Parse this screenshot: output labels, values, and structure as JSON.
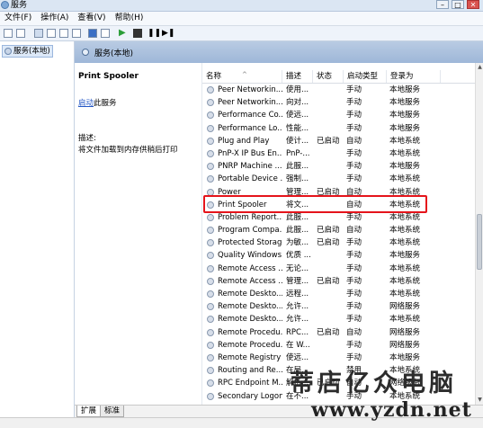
{
  "window": {
    "title": "服务"
  },
  "menu": [
    "文件(F)",
    "操作(A)",
    "查看(V)",
    "帮助(H)"
  ],
  "tree": {
    "item": "服务(本地)"
  },
  "header": {
    "title": "服务(本地)"
  },
  "detail": {
    "service_name": "Print Spooler",
    "action_link": "启动",
    "action_suffix": "此服务",
    "desc_label": "描述:",
    "desc_text": "将文件加载到内存供稍后打印"
  },
  "columns": [
    "名称",
    "描述",
    "状态",
    "启动类型",
    "登录为"
  ],
  "rows": [
    {
      "name": "Peer Networkin...",
      "desc": "使用...",
      "status": "",
      "start": "手动",
      "login": "本地服务"
    },
    {
      "name": "Peer Networkin...",
      "desc": "向对...",
      "status": "",
      "start": "手动",
      "login": "本地服务"
    },
    {
      "name": "Performance Co...",
      "desc": "使远...",
      "status": "",
      "start": "手动",
      "login": "本地服务"
    },
    {
      "name": "Performance Lo...",
      "desc": "性能...",
      "status": "",
      "start": "手动",
      "login": "本地服务"
    },
    {
      "name": "Plug and Play",
      "desc": "使计...",
      "status": "已启动",
      "start": "自动",
      "login": "本地系统"
    },
    {
      "name": "PnP-X IP Bus En...",
      "desc": "PnP-...",
      "status": "",
      "start": "手动",
      "login": "本地系统"
    },
    {
      "name": "PNRP Machine ...",
      "desc": "此服...",
      "status": "",
      "start": "手动",
      "login": "本地服务"
    },
    {
      "name": "Portable Device ...",
      "desc": "强制...",
      "status": "",
      "start": "手动",
      "login": "本地系统"
    },
    {
      "name": "Power",
      "desc": "管理...",
      "status": "已启动",
      "start": "自动",
      "login": "本地系统"
    },
    {
      "name": "Print Spooler",
      "desc": "将文...",
      "status": "",
      "start": "自动",
      "login": "本地系统"
    },
    {
      "name": "Problem Report...",
      "desc": "此服...",
      "status": "",
      "start": "手动",
      "login": "本地系统"
    },
    {
      "name": "Program Compa...",
      "desc": "此服...",
      "status": "已启动",
      "start": "自动",
      "login": "本地系统"
    },
    {
      "name": "Protected Storage",
      "desc": "为敏...",
      "status": "已启动",
      "start": "手动",
      "login": "本地系统"
    },
    {
      "name": "Quality Windows...",
      "desc": "优质 ...",
      "status": "",
      "start": "手动",
      "login": "本地服务"
    },
    {
      "name": "Remote Access ...",
      "desc": "无论...",
      "status": "",
      "start": "手动",
      "login": "本地系统"
    },
    {
      "name": "Remote Access ...",
      "desc": "管理...",
      "status": "已启动",
      "start": "手动",
      "login": "本地系统"
    },
    {
      "name": "Remote Deskto...",
      "desc": "远程...",
      "status": "",
      "start": "手动",
      "login": "本地系统"
    },
    {
      "name": "Remote Deskto...",
      "desc": "允许...",
      "status": "",
      "start": "手动",
      "login": "网络服务"
    },
    {
      "name": "Remote Deskto...",
      "desc": "允许...",
      "status": "",
      "start": "手动",
      "login": "本地系统"
    },
    {
      "name": "Remote Procedu...",
      "desc": "RPC...",
      "status": "已启动",
      "start": "自动",
      "login": "网络服务"
    },
    {
      "name": "Remote Procedu...",
      "desc": "在 W...",
      "status": "",
      "start": "手动",
      "login": "网络服务"
    },
    {
      "name": "Remote Registry",
      "desc": "使远...",
      "status": "",
      "start": "手动",
      "login": "本地服务"
    },
    {
      "name": "Routing and Re...",
      "desc": "在局...",
      "status": "",
      "start": "禁用",
      "login": "本地系统"
    },
    {
      "name": "RPC Endpoint M...",
      "desc": "解析...",
      "status": "已启动",
      "start": "自动",
      "login": "网络服务"
    },
    {
      "name": "Secondary Logon",
      "desc": "在不...",
      "status": "",
      "start": "手动",
      "login": "本地系统"
    }
  ],
  "tabs": [
    "扩展",
    "标准"
  ],
  "watermark": {
    "text": "蒂店亿众电脑",
    "url": "www.yzdn.net"
  }
}
